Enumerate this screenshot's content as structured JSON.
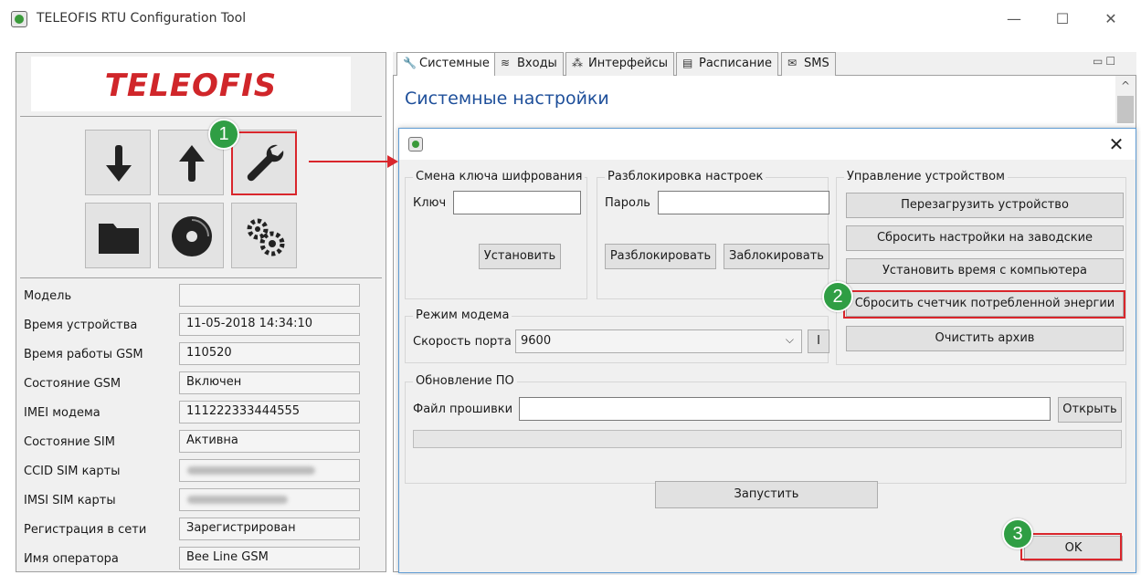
{
  "window": {
    "title": "TELEOFIS RTU Configuration Tool",
    "minimize": "—",
    "maximize": "☐",
    "close": "✕"
  },
  "logo": {
    "text": "TELEOFIS"
  },
  "toolbar": {
    "buttons": [
      {
        "name": "download-icon"
      },
      {
        "name": "upload-icon"
      },
      {
        "name": "wrench-icon"
      },
      {
        "name": "folder-icon"
      },
      {
        "name": "disc-icon"
      },
      {
        "name": "gears-icon"
      }
    ]
  },
  "info": [
    {
      "label": "Модель",
      "value": ""
    },
    {
      "label": "Время устройства",
      "value": "11-05-2018 14:34:10"
    },
    {
      "label": "Время работы GSM",
      "value": "110520"
    },
    {
      "label": "Состояние GSM",
      "value": "Включен"
    },
    {
      "label": "IMEI модема",
      "value": "111222333444555"
    },
    {
      "label": "Состояние SIM",
      "value": "Активна"
    },
    {
      "label": "CCID SIM карты",
      "value": ""
    },
    {
      "label": "IMSI SIM карты",
      "value": ""
    },
    {
      "label": "Регистрация в сети",
      "value": "Зарегистрирован"
    },
    {
      "label": "Имя оператора",
      "value": "Bee Line GSM"
    }
  ],
  "tabs": [
    {
      "label": "Системные",
      "icon": "wrench-icon",
      "glyph": "🔧",
      "active": true
    },
    {
      "label": "Входы",
      "icon": "database-icon",
      "glyph": "≋",
      "active": false
    },
    {
      "label": "Интерфейсы",
      "icon": "network-icon",
      "glyph": "⁂",
      "active": false
    },
    {
      "label": "Расписание",
      "icon": "document-icon",
      "glyph": "▤",
      "active": false
    },
    {
      "label": "SMS",
      "icon": "envelope-icon",
      "glyph": "✉",
      "active": false
    }
  ],
  "panel": {
    "title": "Системные настройки"
  },
  "dialog": {
    "close": "✕",
    "key_group": {
      "legend": "Смена ключа шифрования",
      "key_label": "Ключ",
      "key_value": "",
      "set_button": "Установить"
    },
    "unlock_group": {
      "legend": "Разблокировка настроек",
      "password_label": "Пароль",
      "password_value": "",
      "unlock_button": "Разблокировать",
      "lock_button": "Заблокировать"
    },
    "device_group": {
      "legend": "Управление устройством",
      "buttons": [
        "Перезагрузить устройство",
        "Сбросить настройки на заводские",
        "Установить время с компьютера",
        "Сбросить счетчик потребленной энергии",
        "Очистить архив"
      ]
    },
    "modem_group": {
      "legend": "Режим модема",
      "port_label": "Скорость порта",
      "port_value": "9600",
      "extra_button": "I"
    },
    "firmware_group": {
      "legend": "Обновление ПО",
      "file_label": "Файл прошивки",
      "file_value": "",
      "open_button": "Открыть",
      "progress": 0,
      "run_button": "Запустить"
    },
    "ok_button": "OK"
  },
  "annotations": {
    "step1": "1",
    "step2": "2",
    "step3": "3",
    "highlight_color": "#d9262c",
    "badge_color": "#2f9e44"
  }
}
